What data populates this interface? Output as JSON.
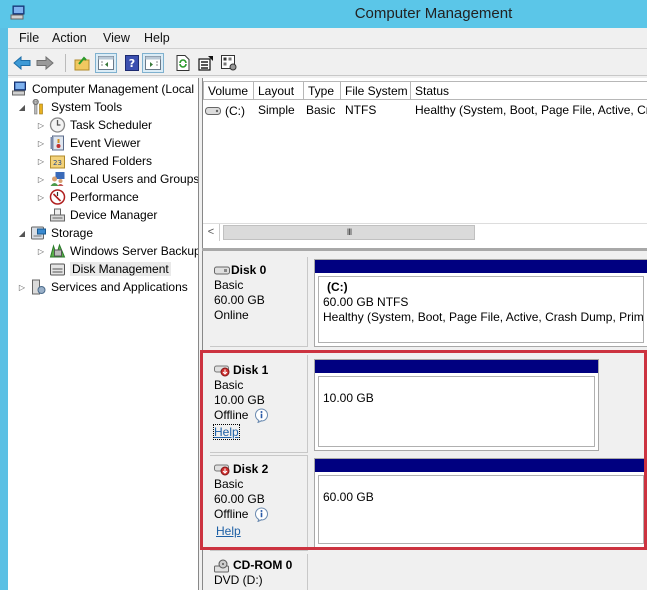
{
  "window": {
    "title": "Computer Management",
    "app_icon": "computer-management-icon"
  },
  "menu": [
    "File",
    "Action",
    "View",
    "Help"
  ],
  "toolbar": {
    "buttons": [
      {
        "name": "back-button",
        "icon": "back-arrow-icon"
      },
      {
        "name": "forward-button",
        "icon": "forward-arrow-icon"
      },
      {
        "name": "up-level-button",
        "icon": "folder-up-icon"
      },
      {
        "name": "show-hide-console-tree-button",
        "icon": "console-tree-icon"
      },
      {
        "name": "help-button",
        "icon": "help-icon"
      },
      {
        "name": "show-hide-action-pane-button",
        "icon": "action-pane-icon"
      },
      {
        "name": "refresh-button",
        "icon": "refresh-icon"
      },
      {
        "name": "properties-button",
        "icon": "properties-icon"
      },
      {
        "name": "settings-button",
        "icon": "settings-icon"
      }
    ]
  },
  "tree": {
    "root": "Computer Management (Local",
    "items": [
      {
        "label": "System Tools",
        "expander": "expanded",
        "icon": "tools-icon",
        "level": 1
      },
      {
        "label": "Task Scheduler",
        "expander": "collapsed",
        "icon": "clock-icon",
        "level": 2
      },
      {
        "label": "Event Viewer",
        "expander": "collapsed",
        "icon": "event-viewer-icon",
        "level": 2
      },
      {
        "label": "Shared Folders",
        "expander": "collapsed",
        "icon": "shared-folder-icon",
        "level": 2
      },
      {
        "label": "Local Users and Groups",
        "expander": "collapsed",
        "icon": "users-icon",
        "level": 2
      },
      {
        "label": "Performance",
        "expander": "collapsed",
        "icon": "performance-icon",
        "level": 2
      },
      {
        "label": "Device Manager",
        "expander": "none",
        "icon": "device-manager-icon",
        "level": 2
      },
      {
        "label": "Storage",
        "expander": "expanded",
        "icon": "storage-icon",
        "level": 1
      },
      {
        "label": "Windows Server Backup",
        "expander": "collapsed",
        "icon": "backup-icon",
        "level": 2
      },
      {
        "label": "Disk Management",
        "expander": "none",
        "icon": "disk-management-icon",
        "level": 2,
        "selected": true
      },
      {
        "label": "Services and Applications",
        "expander": "collapsed",
        "icon": "services-icon",
        "level": 1
      }
    ]
  },
  "volume_list": {
    "columns": [
      "Volume",
      "Layout",
      "Type",
      "File System",
      "Status"
    ],
    "rows": [
      {
        "volume": "(C:)",
        "layout": "Simple",
        "type": "Basic",
        "file_system": "NTFS",
        "status": "Healthy (System, Boot, Page File, Active, Cr"
      }
    ],
    "scroll_glyph": "III",
    "scroll_left": "<"
  },
  "disks": [
    {
      "name": "Disk 0",
      "type": "Basic",
      "size": "60.00 GB",
      "state": "Online",
      "volume": {
        "label": "(C:)",
        "size_fs": "60.00 GB NTFS",
        "status": "Healthy (System, Boot, Page File, Active, Crash Dump, Primar"
      }
    },
    {
      "name": "Disk 1",
      "type": "Basic",
      "size": "10.00 GB",
      "state": "Offline",
      "help": "Help",
      "volume": {
        "size": "10.00 GB"
      }
    },
    {
      "name": "Disk 2",
      "type": "Basic",
      "size": "60.00 GB",
      "state": "Offline",
      "help": "Help",
      "volume": {
        "size": "60.00 GB"
      }
    },
    {
      "name": "CD-ROM 0",
      "type": "DVD (D:)"
    }
  ],
  "colors": {
    "titlebar": "#5bc6e8",
    "volume_bar": "#000080",
    "highlight": "#cc3340",
    "link": "#1d5fa5"
  }
}
